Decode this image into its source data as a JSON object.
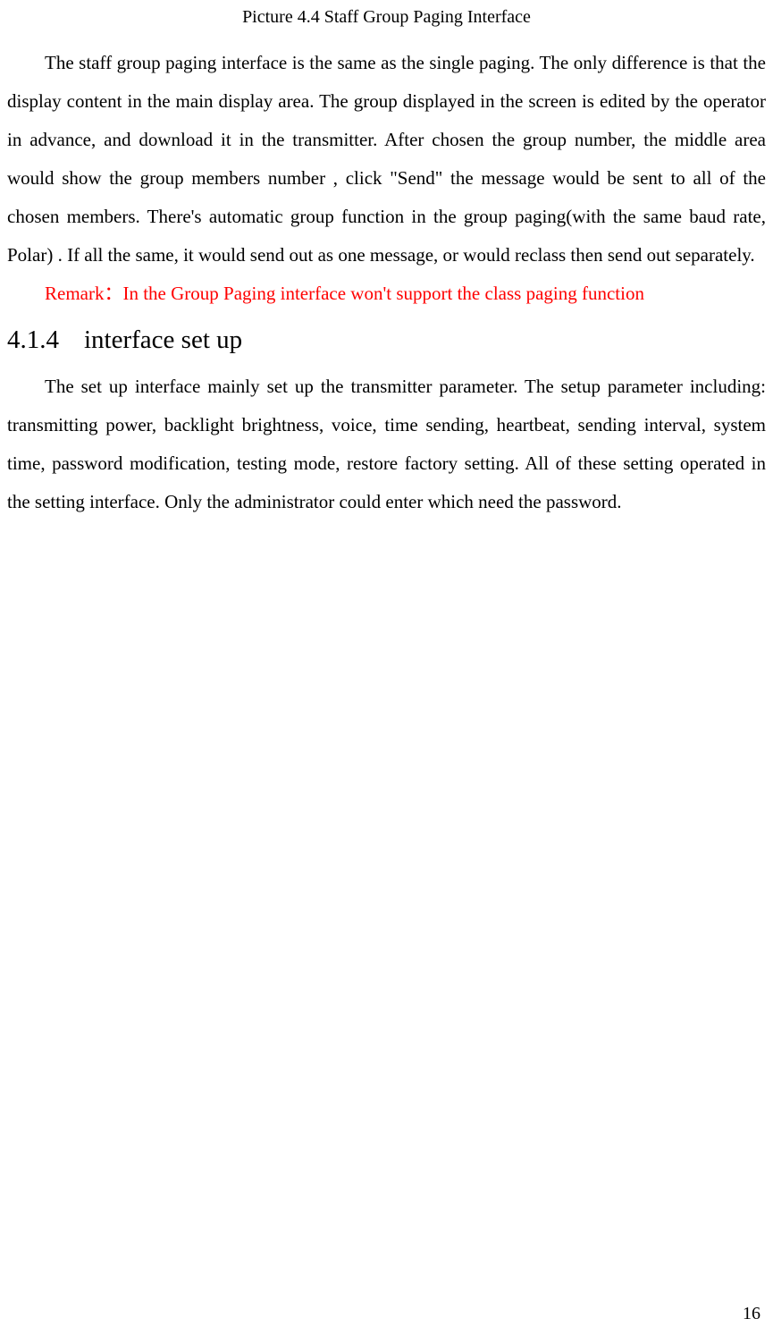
{
  "caption": "Picture 4.4    Staff Group Paging Interface",
  "paragraph1": "The staff group paging interface is the same as the single paging. The only difference is that the display content in the main display area. The group displayed in the screen is edited by the operator in advance, and download it in the transmitter. After chosen the group number, the middle area would show the group members number , click \"Send\" the message would be sent to all of the chosen members. There's automatic group function in the group paging(with the same baud rate, Polar) . If all the same, it would send out as one message, or would reclass then send out separately.",
  "remark": "Remark：In the Group Paging interface won't support the class paging function",
  "section": {
    "number": "4.1.4",
    "title": "interface set up"
  },
  "paragraph2": "The set up interface mainly set up the transmitter parameter. The setup parameter including: transmitting power, backlight brightness, voice, time sending, heartbeat, sending interval, system time, password modification, testing mode, restore factory setting. All of these setting operated in the setting interface. Only the administrator could enter which need the password.",
  "pageNumber": "16"
}
